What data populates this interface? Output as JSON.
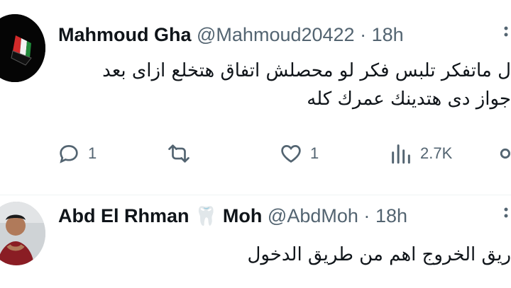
{
  "tweets": [
    {
      "author_name": "Mahmoud Gha",
      "handle": "@Mahmoud20422",
      "separator": "·",
      "time": "18h",
      "text_lines": [
        "ل ماتفكر تلبس فكر لو محصلش اتفاق هتخلع ازاى بعد",
        "جواز دى هتدينك عمرك كله"
      ],
      "replies": "1",
      "retweets": "",
      "likes": "1",
      "views": "2.7K"
    },
    {
      "author_name": "Abd El Rhman",
      "name_emoji": "🦷",
      "name_suffix": "Moh",
      "handle": "@AbdMoh",
      "separator": "·",
      "time": "18h",
      "text_lines": [
        "ريق الخروج اهم من طريق الدخول"
      ]
    }
  ],
  "icons": [
    "reply-icon",
    "retweet-icon",
    "like-icon",
    "views-icon",
    "share-icon"
  ],
  "colors": {
    "text": "#0f1419",
    "secondary": "#536471",
    "divider": "#eff3f4"
  }
}
